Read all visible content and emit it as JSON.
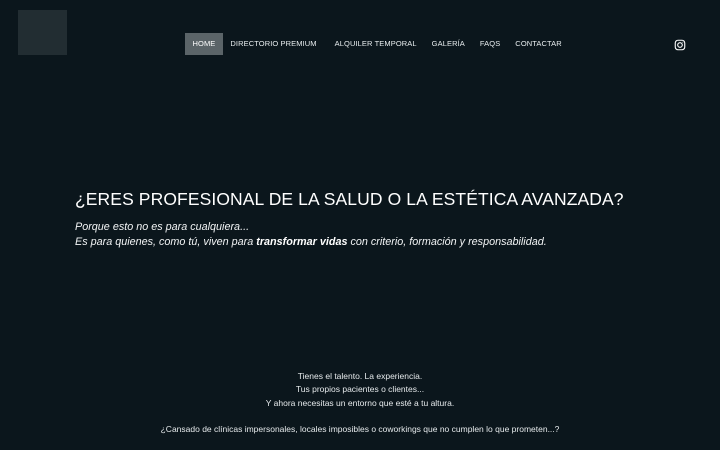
{
  "brand": {
    "logo_color": "#222d32",
    "background": "#0b161c",
    "active_nav_bg": "#5b6468"
  },
  "nav": {
    "items": [
      {
        "label": "HOME"
      },
      {
        "label": "DIRECTORIO PREMIUM"
      },
      {
        "label": "ALQUILER TEMPORAL"
      },
      {
        "label": "GALERÍA"
      },
      {
        "label": "FAQS"
      },
      {
        "label": "CONTACTAR"
      }
    ],
    "social_icon": "instagram-icon"
  },
  "hero": {
    "title": "¿ERES PROFESIONAL DE LA SALUD O LA ESTÉTICA AVANZADA?",
    "line1": "Porque esto no es para cualquiera...",
    "line2_before": "Es para quienes, como tú, viven para ",
    "line2_bold": "transformar vidas",
    "line2_after": " con criterio, formación y responsabilidad."
  },
  "intro": {
    "line1": "Tienes el talento. La experiencia.",
    "line2": "Tus propios pacientes o clientes...",
    "line3": "Y ahora necesitas un entorno que esté a tu altura.",
    "line4": "¿Cansado de clínicas impersonales, locales imposibles o coworkings que no cumplen lo que prometen...?"
  }
}
